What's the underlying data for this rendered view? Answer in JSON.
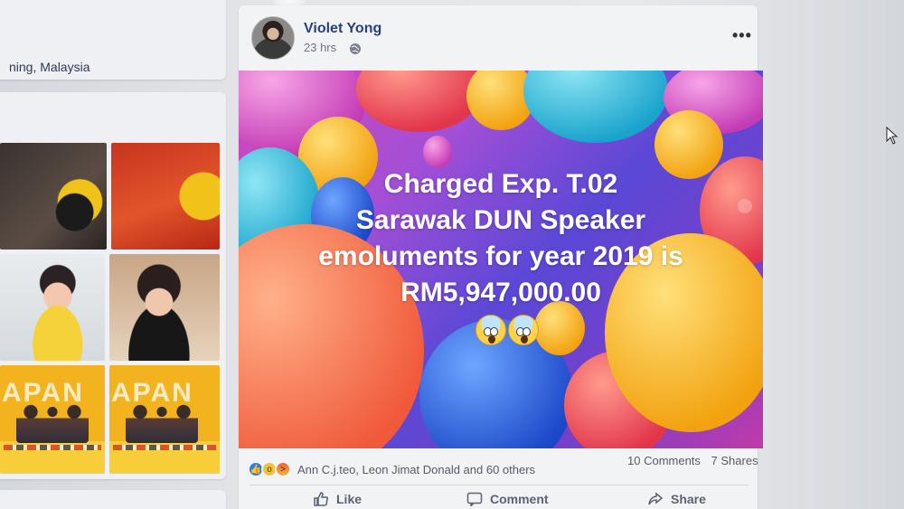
{
  "left_column": {
    "location_text": "ning, Malaysia",
    "photo_banner_word": "APAN"
  },
  "post": {
    "author": "Violet Yong",
    "timestamp": "23 hrs",
    "privacy_icon": "globe-icon",
    "more_icon": "more-options-icon",
    "more_glyph": "•••",
    "image_text_lines": [
      "Charged Exp. T.02",
      "Sarawak DUN Speaker",
      "emoluments for year 2019 is",
      "RM5,947,000.00"
    ],
    "reactions": {
      "icons": [
        "like-icon",
        "wow-icon",
        "angry-icon"
      ],
      "names_text": "Ann C.j.teo, Leon Jimat Donald and 60 others"
    },
    "counts": {
      "comments": "10 Comments",
      "shares": "7 Shares"
    },
    "actions": {
      "like": "Like",
      "comment": "Comment",
      "share": "Share"
    }
  },
  "colors": {
    "author_link": "#28417a",
    "like_blue": "#2f7de1",
    "page_bg": "#e6e8ec"
  }
}
